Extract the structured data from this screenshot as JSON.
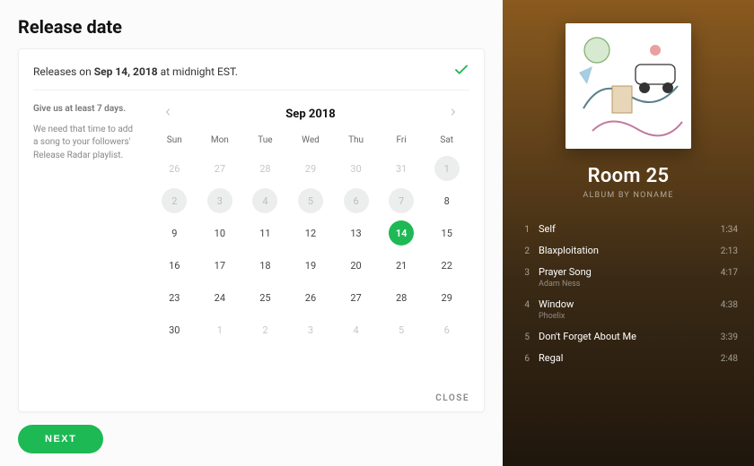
{
  "page": {
    "title": "Release date",
    "release_prefix": "Releases on ",
    "release_date": "Sep 14, 2018",
    "release_suffix": " at midnight EST.",
    "close_label": "CLOSE",
    "next_label": "NEXT"
  },
  "hint": {
    "title": "Give us at least 7 days.",
    "body": "We need that time to add a song to your followers' Release Radar playlist."
  },
  "calendar": {
    "month_label": "Sep 2018",
    "dow": [
      "Sun",
      "Mon",
      "Tue",
      "Wed",
      "Thu",
      "Fri",
      "Sat"
    ],
    "selected_day": 14,
    "weeks": [
      [
        {
          "n": 26,
          "out": true
        },
        {
          "n": 27,
          "out": true
        },
        {
          "n": 28,
          "out": true
        },
        {
          "n": 29,
          "out": true
        },
        {
          "n": 30,
          "out": true
        },
        {
          "n": 31,
          "out": true
        },
        {
          "n": 1,
          "disabled": true
        }
      ],
      [
        {
          "n": 2,
          "disabled": true
        },
        {
          "n": 3,
          "disabled": true
        },
        {
          "n": 4,
          "disabled": true
        },
        {
          "n": 5,
          "disabled": true
        },
        {
          "n": 6,
          "disabled": true
        },
        {
          "n": 7,
          "disabled": true
        },
        {
          "n": 8
        }
      ],
      [
        {
          "n": 9
        },
        {
          "n": 10
        },
        {
          "n": 11
        },
        {
          "n": 12
        },
        {
          "n": 13
        },
        {
          "n": 14,
          "selected": true
        },
        {
          "n": 15
        }
      ],
      [
        {
          "n": 16
        },
        {
          "n": 17
        },
        {
          "n": 18
        },
        {
          "n": 19
        },
        {
          "n": 20
        },
        {
          "n": 21
        },
        {
          "n": 22
        }
      ],
      [
        {
          "n": 23
        },
        {
          "n": 24
        },
        {
          "n": 25
        },
        {
          "n": 26
        },
        {
          "n": 27
        },
        {
          "n": 28
        },
        {
          "n": 29
        }
      ],
      [
        {
          "n": 30
        },
        {
          "n": 1,
          "out": true
        },
        {
          "n": 2,
          "out": true
        },
        {
          "n": 3,
          "out": true
        },
        {
          "n": 4,
          "out": true
        },
        {
          "n": 5,
          "out": true
        },
        {
          "n": 6,
          "out": true
        }
      ]
    ]
  },
  "album": {
    "title": "Room 25",
    "subtitle": "ALBUM BY NONAME",
    "tracks": [
      {
        "num": "1",
        "name": "Self",
        "duration": "1:34"
      },
      {
        "num": "2",
        "name": "Blaxploitation",
        "duration": "2:13"
      },
      {
        "num": "3",
        "name": "Prayer Song",
        "artist": "Adam Ness",
        "duration": "4:17"
      },
      {
        "num": "4",
        "name": "Window",
        "artist": "Phoelix",
        "duration": "4:38"
      },
      {
        "num": "5",
        "name": "Don't Forget About Me",
        "duration": "3:39"
      },
      {
        "num": "6",
        "name": "Regal",
        "duration": "2:48"
      }
    ]
  },
  "colors": {
    "accent": "#1db954"
  }
}
